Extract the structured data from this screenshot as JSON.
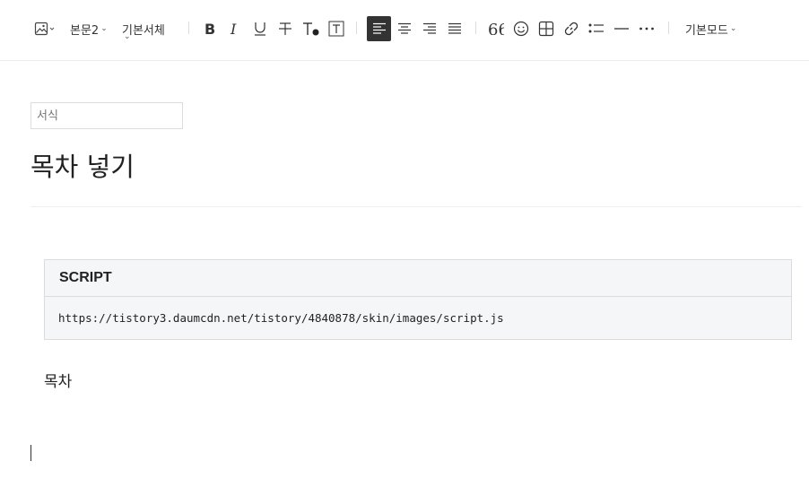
{
  "toolbar": {
    "paragraph_style": "본문2",
    "font_style": "기본서체",
    "mode": "기본모드"
  },
  "editor": {
    "category_placeholder": "서식",
    "title": "목차 넣기",
    "code_block": {
      "header": "SCRIPT",
      "content": "https://tistory3.daumcdn.net/tistory/4840878/skin/images/script.js"
    },
    "body_text": "목차"
  },
  "colors": {
    "active_button_bg": "#333333",
    "code_block_bg": "#f5f6f8",
    "code_block_border": "#dadcdf"
  }
}
